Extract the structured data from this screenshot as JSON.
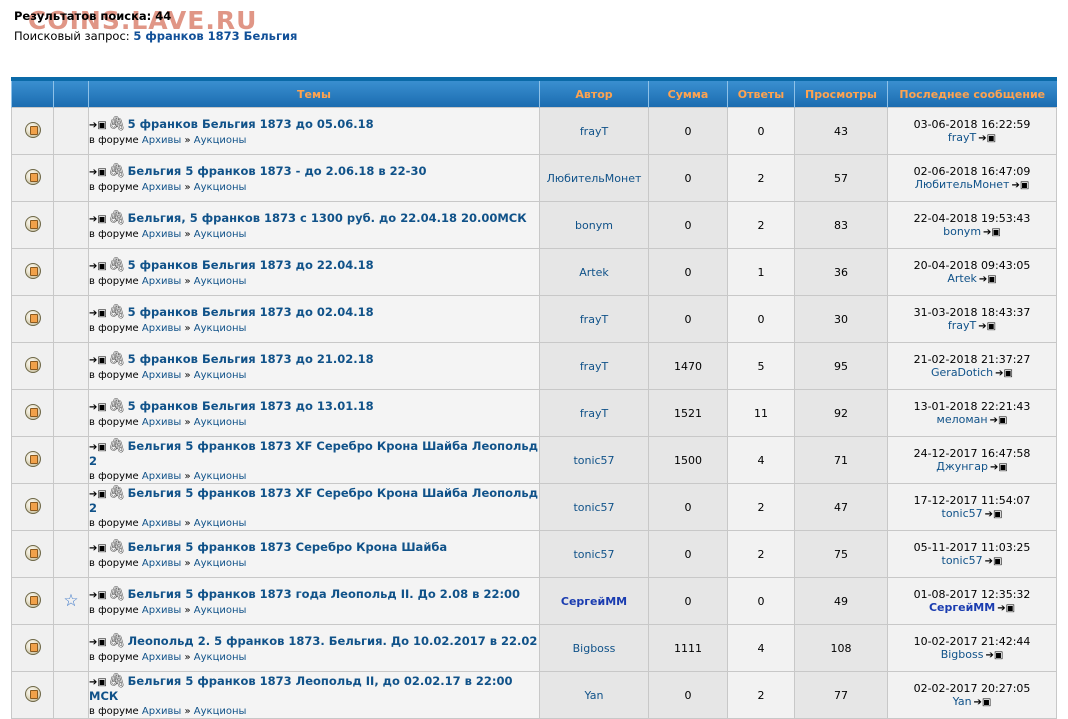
{
  "watermark": "COINS.LAVE.RU",
  "search": {
    "count_label": "Результатов поиска: 44",
    "query_label": "Поисковый запрос:",
    "query": "5 франков 1873 Бельгия"
  },
  "columns": {
    "topics": "Темы",
    "author": "Автор",
    "sum": "Сумма",
    "replies": "Ответы",
    "views": "Просмотры",
    "last": "Последнее сообщение"
  },
  "forum_prefix": "в форуме",
  "forum_path": [
    "Архивы",
    "Аукционы"
  ],
  "forum_sep": "»",
  "rows": [
    {
      "title": "5 франков Бельгия 1873 до 05.06.18",
      "author": "frayT",
      "sum": "0",
      "replies": "0",
      "views": "43",
      "last_date": "03-06-2018 16:22:59",
      "last_user": "frayT",
      "starred": false
    },
    {
      "title": "Бельгия 5 франков 1873 - до 2.06.18 в 22-30",
      "author": "ЛюбительМонет",
      "sum": "0",
      "replies": "2",
      "views": "57",
      "last_date": "02-06-2018 16:47:09",
      "last_user": "ЛюбительМонет",
      "starred": false
    },
    {
      "title": "Бельгия, 5 франков 1873 с 1300 руб. до 22.04.18 20.00МСК",
      "author": "bonym",
      "sum": "0",
      "replies": "2",
      "views": "83",
      "last_date": "22-04-2018 19:53:43",
      "last_user": "bonym",
      "starred": false
    },
    {
      "title": "5 франков Бельгия 1873 до 22.04.18",
      "author": "Artek",
      "sum": "0",
      "replies": "1",
      "views": "36",
      "last_date": "20-04-2018 09:43:05",
      "last_user": "Artek",
      "starred": false
    },
    {
      "title": "5 франков Бельгия 1873 до 02.04.18",
      "author": "frayT",
      "sum": "0",
      "replies": "0",
      "views": "30",
      "last_date": "31-03-2018 18:43:37",
      "last_user": "frayT",
      "starred": false
    },
    {
      "title": "5 франков Бельгия 1873 до 21.02.18",
      "author": "frayT",
      "sum": "1470",
      "replies": "5",
      "views": "95",
      "last_date": "21-02-2018 21:37:27",
      "last_user": "GeraDotich",
      "starred": false
    },
    {
      "title": "5 франков Бельгия 1873 до 13.01.18",
      "author": "frayT",
      "sum": "1521",
      "replies": "11",
      "views": "92",
      "last_date": "13-01-2018 22:21:43",
      "last_user": "меломан",
      "starred": false
    },
    {
      "title": "Бельгия 5 франков 1873 XF Серебро Крона Шайба Леопольд 2",
      "author": "tonic57",
      "sum": "1500",
      "replies": "4",
      "views": "71",
      "last_date": "24-12-2017 16:47:58",
      "last_user": "Джунгар",
      "starred": false
    },
    {
      "title": "Бельгия 5 франков 1873 XF Серебро Крона Шайба Леопольд 2",
      "author": "tonic57",
      "sum": "0",
      "replies": "2",
      "views": "47",
      "last_date": "17-12-2017 11:54:07",
      "last_user": "tonic57",
      "starred": false
    },
    {
      "title": "Бельгия 5 франков 1873 Серебро Крона Шайба",
      "author": "tonic57",
      "sum": "0",
      "replies": "2",
      "views": "75",
      "last_date": "05-11-2017 11:03:25",
      "last_user": "tonic57",
      "starred": false
    },
    {
      "title": "Бельгия 5 франков 1873 года Леопольд II. До 2.08 в 22:00",
      "author": "СергейММ",
      "sum": "0",
      "replies": "0",
      "views": "49",
      "last_date": "01-08-2017 12:35:32",
      "last_user": "СергейММ",
      "starred": true
    },
    {
      "title": "Леопольд 2. 5 франков 1873. Бельгия. До 10.02.2017 в 22.02",
      "author": "Bigboss",
      "sum": "1111",
      "replies": "4",
      "views": "108",
      "last_date": "10-02-2017 21:42:44",
      "last_user": "Bigboss",
      "starred": false
    },
    {
      "title": "Бельгия 5 франков 1873 Леопольд II, до 02.02.17 в 22:00 МСК",
      "author": "Yan",
      "sum": "0",
      "replies": "2",
      "views": "77",
      "last_date": "02-02-2017 20:27:05",
      "last_user": "Yan",
      "starred": false
    }
  ]
}
